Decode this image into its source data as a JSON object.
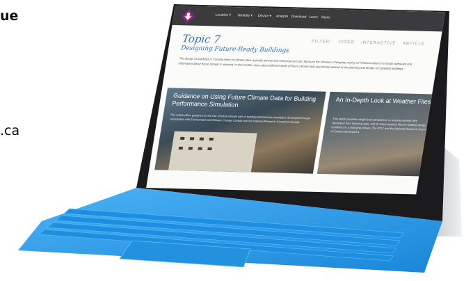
{
  "left_text": {
    "line1": "ue",
    "line2": ".ca"
  },
  "screen": {
    "nav": {
      "items": [
        "Location ▾",
        "Variable ▾",
        "Device ▾",
        "Analyze",
        "Download",
        "Learn",
        "News"
      ]
    },
    "title": "Topic 7",
    "subtitle": "Designing Future-Ready Buildings",
    "filter_tabs": [
      "FILTER:",
      "VIDEO",
      "INTERACTIVE",
      "ARTICLE"
    ],
    "intro": "The design of buildings in Canada relies on climate data, typically derived from historical records. Because the climate is changing, relying on historical data is no longer adequate and information about future climate is required. In this section, learn about different kinds of future climate data specifically tailored to the planning and design of Canadian buildings.",
    "cards": [
      {
        "title": "Guidance on Using Future Climate Data for Building Performance Simulation",
        "desc": "This article offers guidance on the use of future climate data in building performance simulation, developed through consultation with Environment and Climate Change Canada and the National Research Council of Canada."
      },
      {
        "title": "An In-Depth Look at Weather Files",
        "desc": "This article provides a high-level perspective on existing weather files developed from historical data, and on future weather files for building design conditions in a changing climate. The PCIC and the National Research Council of Canada developed a"
      }
    ]
  },
  "colors": {
    "nav_bg": "#3b3b3d",
    "accent_blue": "#2f6fae",
    "keyboard_blue": "#2a9be6",
    "logo_purple": "#7a2a8f",
    "logo_red": "#d4304a"
  }
}
